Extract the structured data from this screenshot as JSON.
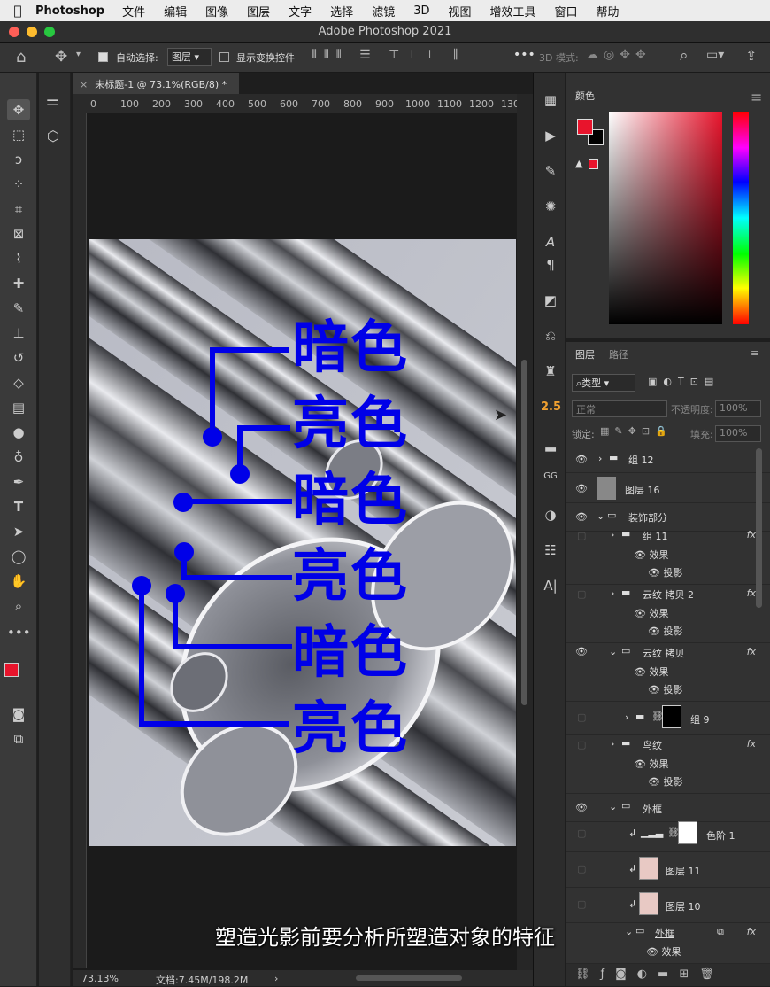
{
  "menubar": {
    "app": "Photoshop",
    "items": [
      "文件",
      "编辑",
      "图像",
      "图层",
      "文字",
      "选择",
      "滤镜",
      "3D",
      "视图",
      "增效工具",
      "窗口",
      "帮助"
    ]
  },
  "window": {
    "title": "Adobe Photoshop 2021"
  },
  "options": {
    "auto_select_label": "自动选择:",
    "auto_select_value": "图层",
    "show_transform_label": "显示变换控件",
    "mode_3d_label": "3D 模式:",
    "more": "•••"
  },
  "document": {
    "tab": "未标题-1 @ 73.1%(RGB/8) *",
    "zoom": "73.13%",
    "doc_info": "文档:7.45M/198.2M",
    "ruler_marks": [
      "0",
      "100",
      "200",
      "300",
      "400",
      "500",
      "600",
      "700",
      "800",
      "900",
      "1000",
      "1100",
      "1200",
      "130"
    ]
  },
  "annotations": {
    "labels": [
      "暗色",
      "亮色",
      "暗色",
      "亮色",
      "暗色",
      "亮色"
    ]
  },
  "panels": {
    "color": {
      "tab": "颜色",
      "fg": "#e8142c",
      "bg": "#000000",
      "warning_swatch": "#e8142c"
    },
    "layers": {
      "tab": "图层",
      "paths_tab": "路径",
      "filter": "类型",
      "blend_mode": "正常",
      "opacity_label": "不透明度:",
      "opacity": "100%",
      "lock_label": "锁定:",
      "fill_label": "填充:",
      "fill": "100%",
      "rows": [
        {
          "name": "组 12",
          "effect": ""
        },
        {
          "name": "图层 16",
          "effect": ""
        },
        {
          "name": "装饰部分",
          "effect": ""
        },
        {
          "name": "组 11",
          "effect": "fx"
        },
        {
          "name": "云纹 拷贝 2",
          "effect": "fx"
        },
        {
          "name": "云纹 拷贝",
          "effect": "fx"
        },
        {
          "name": "组 9",
          "effect": ""
        },
        {
          "name": "鸟纹",
          "effect": "fx"
        },
        {
          "name": "外框",
          "effect": ""
        },
        {
          "name": "色阶 1",
          "effect": ""
        },
        {
          "name": "图层 11",
          "effect": ""
        },
        {
          "name": "图层 10",
          "effect": ""
        },
        {
          "name": "外框",
          "effect": "fx"
        }
      ],
      "effects_label": "效果",
      "shadow_label": "投影"
    }
  },
  "sidebar_number": "2.5",
  "subtitle": "塑造光影前要分析所塑造对象的特征"
}
